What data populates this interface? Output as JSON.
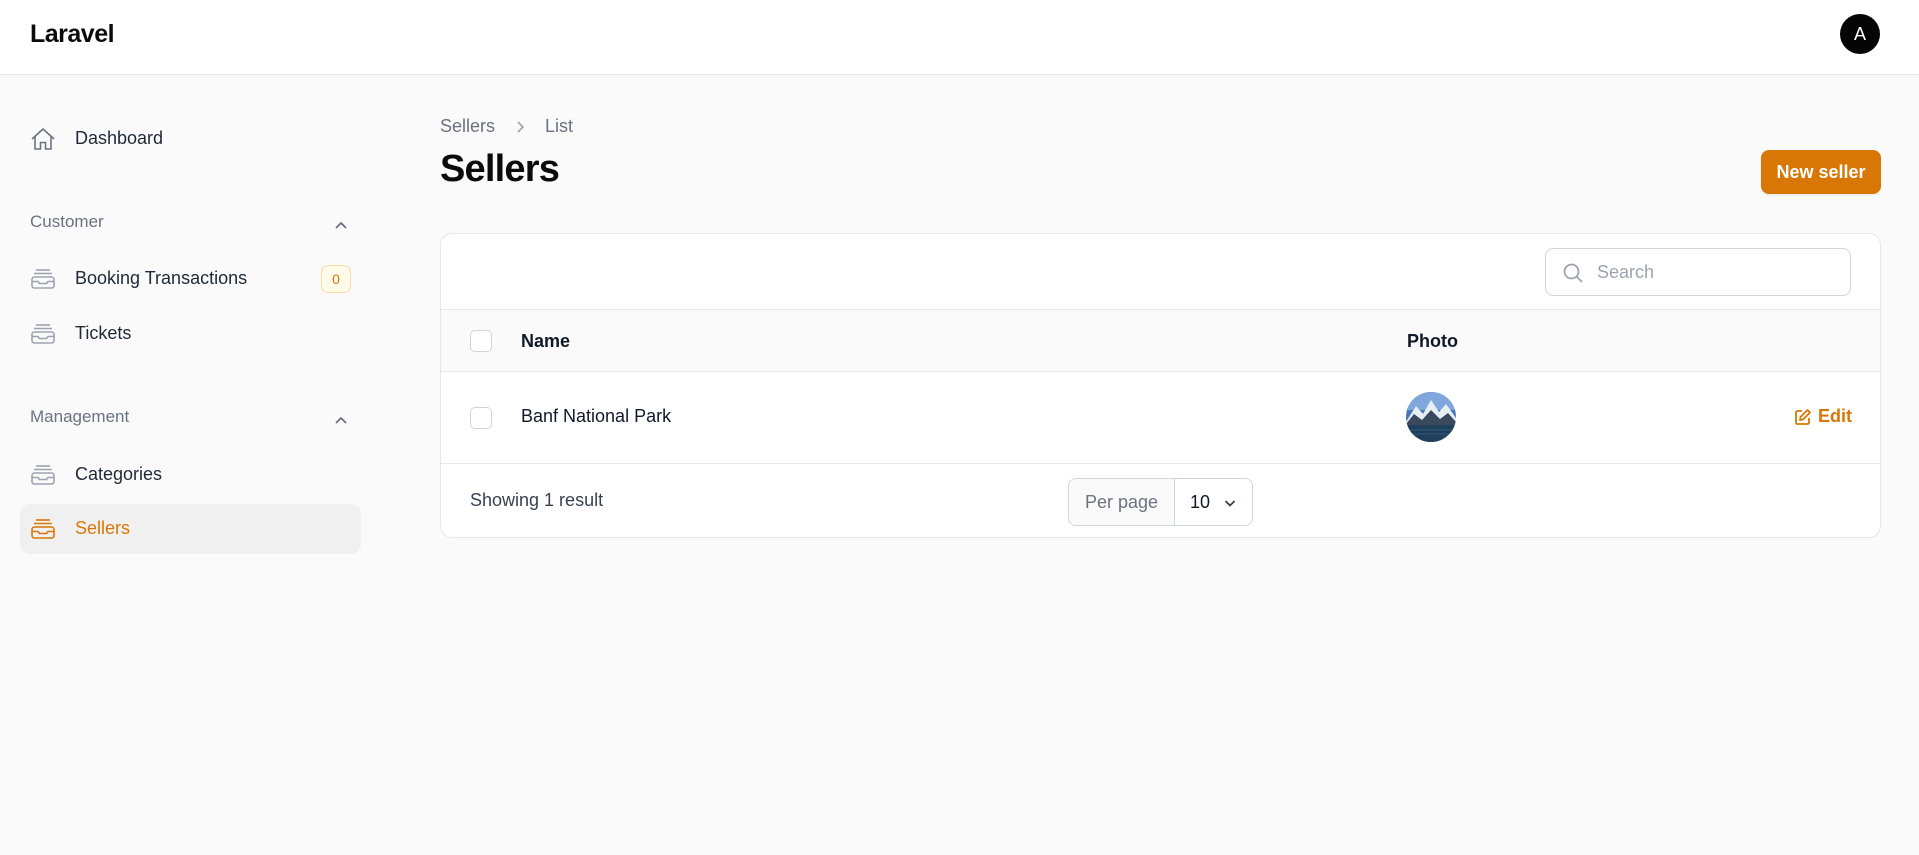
{
  "app": {
    "brand": "Laravel",
    "user_initial": "A"
  },
  "sidebar": {
    "dashboard": {
      "label": "Dashboard",
      "icon": "home-icon"
    },
    "groups": [
      {
        "label": "Customer",
        "collapse_icon": "chevron-up-icon",
        "items": [
          {
            "label": "Booking Transactions",
            "icon": "inbox-stack-icon",
            "badge": "0"
          },
          {
            "label": "Tickets",
            "icon": "inbox-stack-icon"
          }
        ]
      },
      {
        "label": "Management",
        "collapse_icon": "chevron-up-icon",
        "items": [
          {
            "label": "Categories",
            "icon": "inbox-stack-icon"
          },
          {
            "label": "Sellers",
            "icon": "inbox-stack-icon",
            "active": true
          }
        ]
      }
    ]
  },
  "breadcrumb": {
    "items": [
      "Sellers",
      "List"
    ]
  },
  "page": {
    "title": "Sellers",
    "new_button": "New seller"
  },
  "table": {
    "search_placeholder": "Search",
    "columns": [
      "Name",
      "Photo"
    ],
    "rows": [
      {
        "name": "Banf National Park",
        "photo": "mountain-lake-photo",
        "action": "Edit"
      }
    ],
    "footer": {
      "showing": "Showing 1 result",
      "per_page_label": "Per page",
      "per_page_value": "10"
    }
  },
  "colors": {
    "accent": "#d97706",
    "background": "#fafafa",
    "border": "#e5e7eb"
  }
}
